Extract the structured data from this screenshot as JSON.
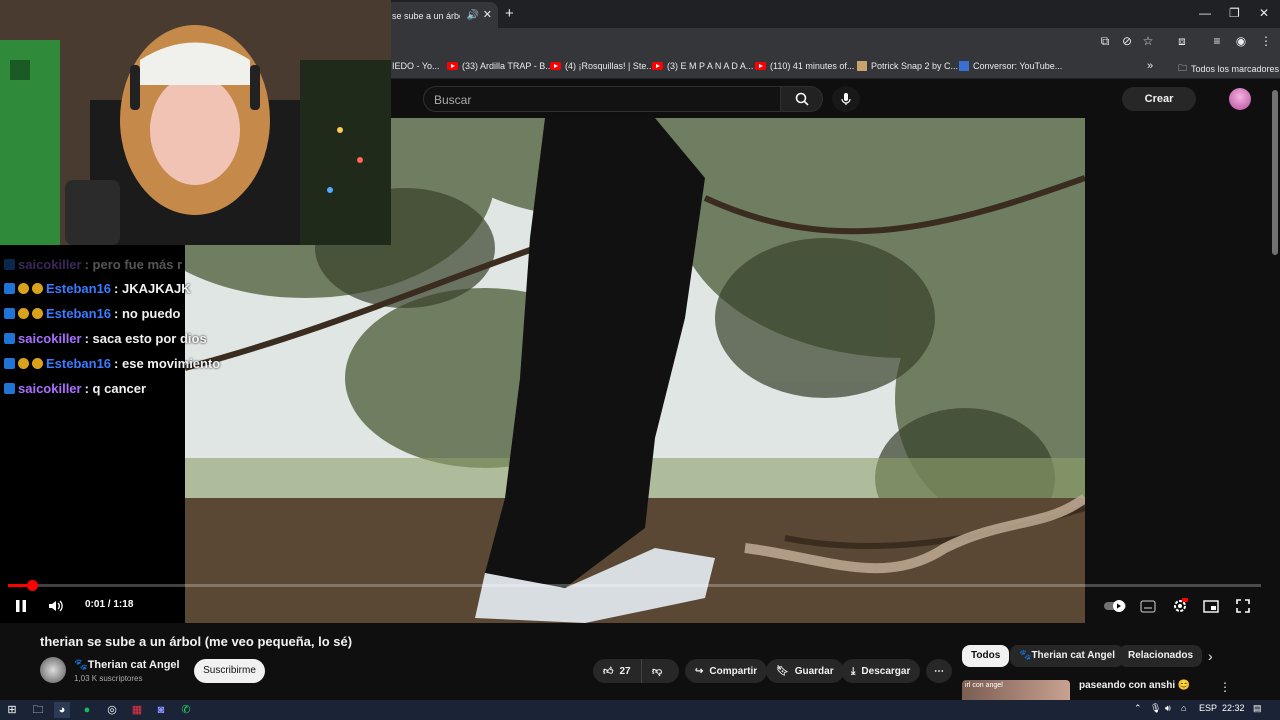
{
  "browser": {
    "tab_title": "se sube a un árbol |",
    "new_tab": "+",
    "window_controls": {
      "minimize": "—",
      "restore": "❐",
      "close": "✕"
    },
    "bookmarks": [
      {
        "label": "IEDO - Yo..."
      },
      {
        "label": "(33) Ardilla TRAP - B..."
      },
      {
        "label": "(4) ¡Rosquillas! | Ste..."
      },
      {
        "label": "(3) E M P A N A D A..."
      },
      {
        "label": "(110) 41 minutes of..."
      },
      {
        "label": "Potrick Snap 2 by C..."
      },
      {
        "label": "Conversor: YouTube..."
      }
    ],
    "bookmarks_more": "»",
    "all_bookmarks": "Todos los marcadores"
  },
  "header": {
    "search_placeholder": "Buscar",
    "create_label": "Crear"
  },
  "chat": [
    {
      "user": "saicokiller",
      "msg": ": pero fue más r",
      "color": "#a970ff"
    },
    {
      "user": "Esteban16",
      "msg": ": JKAJKAJK",
      "color": "#3a7cff"
    },
    {
      "user": "Esteban16",
      "msg": ": no puedo",
      "color": "#3a7cff"
    },
    {
      "user": "saicokiller",
      "msg": ": saca esto por dios",
      "color": "#a970ff"
    },
    {
      "user": "Esteban16",
      "msg": ": ese movimiento",
      "color": "#3a7cff"
    },
    {
      "user": "saicokiller",
      "msg": ": q cancer",
      "color": "#a970ff"
    }
  ],
  "player": {
    "current_time": "0:01",
    "separator": " / ",
    "duration": "1:18",
    "progress": 0.019
  },
  "video": {
    "title": "therian se sube a un árbol (me veo pequeña, lo sé)",
    "channel": "Therian cat Angel",
    "subscribers": "1,03 K suscriptores",
    "subscribe": "Suscribirme",
    "likes": "27",
    "share": "Compartir",
    "save": "Guardar",
    "download": "Descargar"
  },
  "chips": [
    "Todos",
    "Therian cat Angel",
    "Relacionados"
  ],
  "recommendation": {
    "title": "paseando con anshi 😊",
    "thumb_text": "irl con angel"
  },
  "taskbar": {
    "lang": "ESP",
    "clock": "22:32"
  },
  "colors": {
    "accent": "#ff0000",
    "chat_purple": "#a970ff",
    "chat_blue": "#3a7cff"
  }
}
